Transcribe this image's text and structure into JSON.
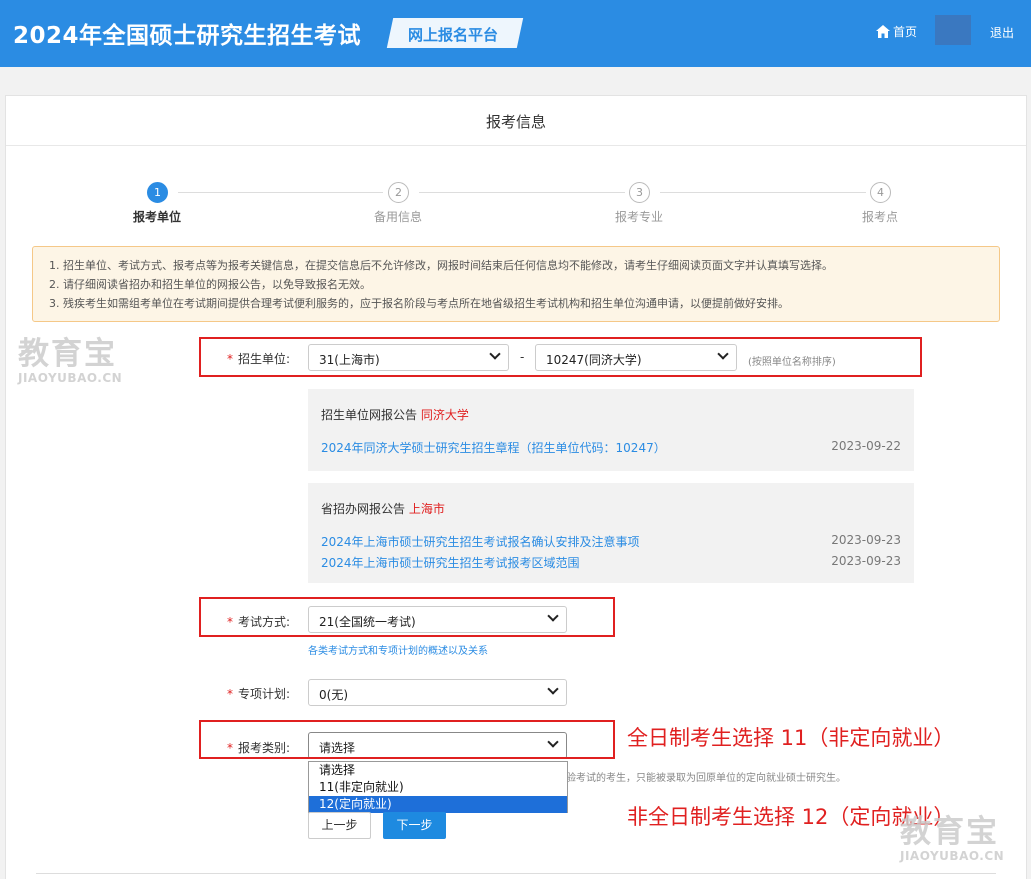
{
  "header": {
    "title": "2024年全国硕士研究生招生考试",
    "platform": "网上报名平台",
    "home": "首页",
    "logout": "退出"
  },
  "card": {
    "title": "报考信息"
  },
  "steps": [
    {
      "num": "1",
      "label": "报考单位",
      "active": true
    },
    {
      "num": "2",
      "label": "备用信息",
      "active": false
    },
    {
      "num": "3",
      "label": "报考专业",
      "active": false
    },
    {
      "num": "4",
      "label": "报考点",
      "active": false
    }
  ],
  "notice": [
    "1. 招生单位、考试方式、报考点等为报考关键信息，在提交信息后不允许修改，网报时间结束后任何信息均不能修改，请考生仔细阅读页面文字并认真填写选择。",
    "2. 请仔细阅读省招办和招生单位的网报公告，以免导致报名无效。",
    "3. 残疾考生如需组考单位在考试期间提供合理考试便利服务的，应于报名阶段与考点所在地省级招生考试机构和招生单位沟通申请，以便提前做好安排。"
  ],
  "form": {
    "unit_label": "招生单位:",
    "province_value": "31(上海市)",
    "dash": "-",
    "school_value": "10247(同济大学)",
    "sort_hint": "(按照单位名称排序)",
    "exam_label": "考试方式:",
    "exam_value": "21(全国统一考试)",
    "exam_link": "各类考试方式和专项计划的概述以及关系",
    "plan_label": "专项计划:",
    "plan_value": "0(无)",
    "category_label": "报考类别:",
    "category_value": "请选择",
    "category_note": "验考试的考生，只能被录取为回原单位的定向就业硕士研究生。",
    "options": [
      "请选择",
      "11(非定向就业)",
      "12(定向就业)"
    ],
    "selected_option": "12(定向就业)"
  },
  "school_notice": {
    "title": "招生单位网报公告",
    "title_red": "同济大学",
    "items": [
      {
        "text": "2024年同济大学硕士研究生招生章程（招生单位代码：10247）",
        "date": "2023-09-22"
      }
    ]
  },
  "province_notice": {
    "title": "省招办网报公告",
    "title_red": "上海市",
    "items": [
      {
        "text": "2024年上海市硕士研究生招生考试报名确认安排及注意事项",
        "date": "2023-09-23"
      },
      {
        "text": "2024年上海市硕士研究生招生考试报考区域范围",
        "date": "2023-09-23"
      }
    ]
  },
  "buttons": {
    "prev": "上一步",
    "next": "下一步"
  },
  "annotations": {
    "fulltime": "全日制考生选择 11（非定向就业）",
    "parttime": "非全日制考生选择 12（定向就业）"
  },
  "watermark": {
    "big": "教育宝",
    "small": "JIAOYUBAO.CN"
  }
}
